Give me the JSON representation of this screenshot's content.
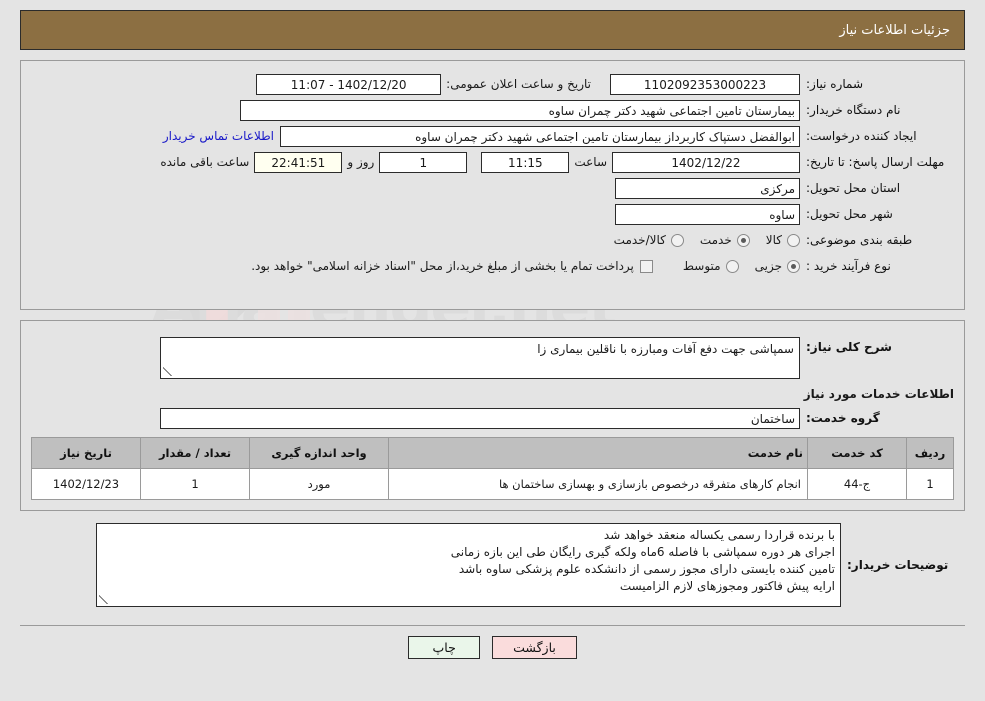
{
  "header": {
    "title": "جزئیات اطلاعات نیاز",
    "bar_color": "#8c6f42"
  },
  "top_panel": {
    "need_number_label": "شماره نیاز:",
    "need_number_value": "1102092353000223",
    "announce_label": "تاریخ و ساعت اعلان عمومی:",
    "announce_value": "1402/12/20 - 11:07",
    "buyer_org_label": "نام دستگاه خریدار:",
    "buyer_org_value": "بیمارستان تامین اجتماعی شهید دکتر چمران ساوه",
    "creator_label": "ایجاد کننده درخواست:",
    "creator_value": "ابوالفضل  دستپاک  کاربرداز بیمارستان تامین اجتماعی شهید دکتر چمران ساوه",
    "contact_link": "اطلاعات تماس خریدار",
    "deadline_label": "مهلت ارسال پاسخ: تا تاریخ:",
    "deadline_date": "1402/12/22",
    "deadline_hour_label": "ساعت",
    "deadline_hour": "11:15",
    "days_value": "1",
    "days_label": "روز و",
    "countdown_value": "22:41:51",
    "countdown_label": "ساعت باقی مانده",
    "province_label": "استان محل تحویل:",
    "province_value": "مرکزی",
    "city_label": "شهر محل تحویل:",
    "city_value": "ساوه",
    "category_label": "طبقه بندی موضوعی:",
    "category_options": [
      {
        "label": "کالا",
        "selected": false
      },
      {
        "label": "خدمت",
        "selected": true
      },
      {
        "label": "کالا/خدمت",
        "selected": false
      }
    ],
    "process_label": "نوع فرآیند خرید :",
    "process_options": [
      {
        "label": "جزیی",
        "selected": true
      },
      {
        "label": "متوسط",
        "selected": false
      }
    ],
    "treasury_checkbox_checked": false,
    "treasury_note": "پرداخت تمام یا بخشی از مبلغ خرید،از محل \"اسناد خزانه اسلامی\" خواهد بود."
  },
  "mid_panel": {
    "general_desc_label": "شرح کلی نیاز:",
    "general_desc_value": "سمپاشی جهت دفع آفات ومبارزه با ناقلین بیماری زا",
    "services_section_title": "اطلاعات خدمات مورد نیاز",
    "service_group_label": "گروه خدمت:",
    "service_group_value": "ساختمان",
    "table": {
      "headers": [
        "ردیف",
        "کد خدمت",
        "نام خدمت",
        "واحد اندازه گیری",
        "تعداد / مقدار",
        "تاریخ نیاز"
      ],
      "rows": [
        {
          "row": "1",
          "code": "ج-44",
          "name": "انجام کارهای متفرقه درخصوص بازسازی و بهسازی ساختمان ها",
          "unit": "مورد",
          "qty": "1",
          "date": "1402/12/23"
        }
      ]
    }
  },
  "bottom_panel": {
    "buyer_notes_label": "توضیحات خریدار:",
    "buyer_notes_lines": [
      "با برنده قراردا رسمی یکساله منعقد خواهد شد",
      "اجرای هر دوره سمپاشی با فاصله 6ماه ولکه گیری رایگان طی این بازه زمانی",
      "تامین کننده بایستی دارای مجوز رسمی از دانشکده علوم پزشکی ساوه باشد",
      "ارایه پیش فاکتور ومجوزهای لازم الزامیست"
    ]
  },
  "footer": {
    "print_label": "چاپ",
    "back_label": "بازگشت"
  }
}
